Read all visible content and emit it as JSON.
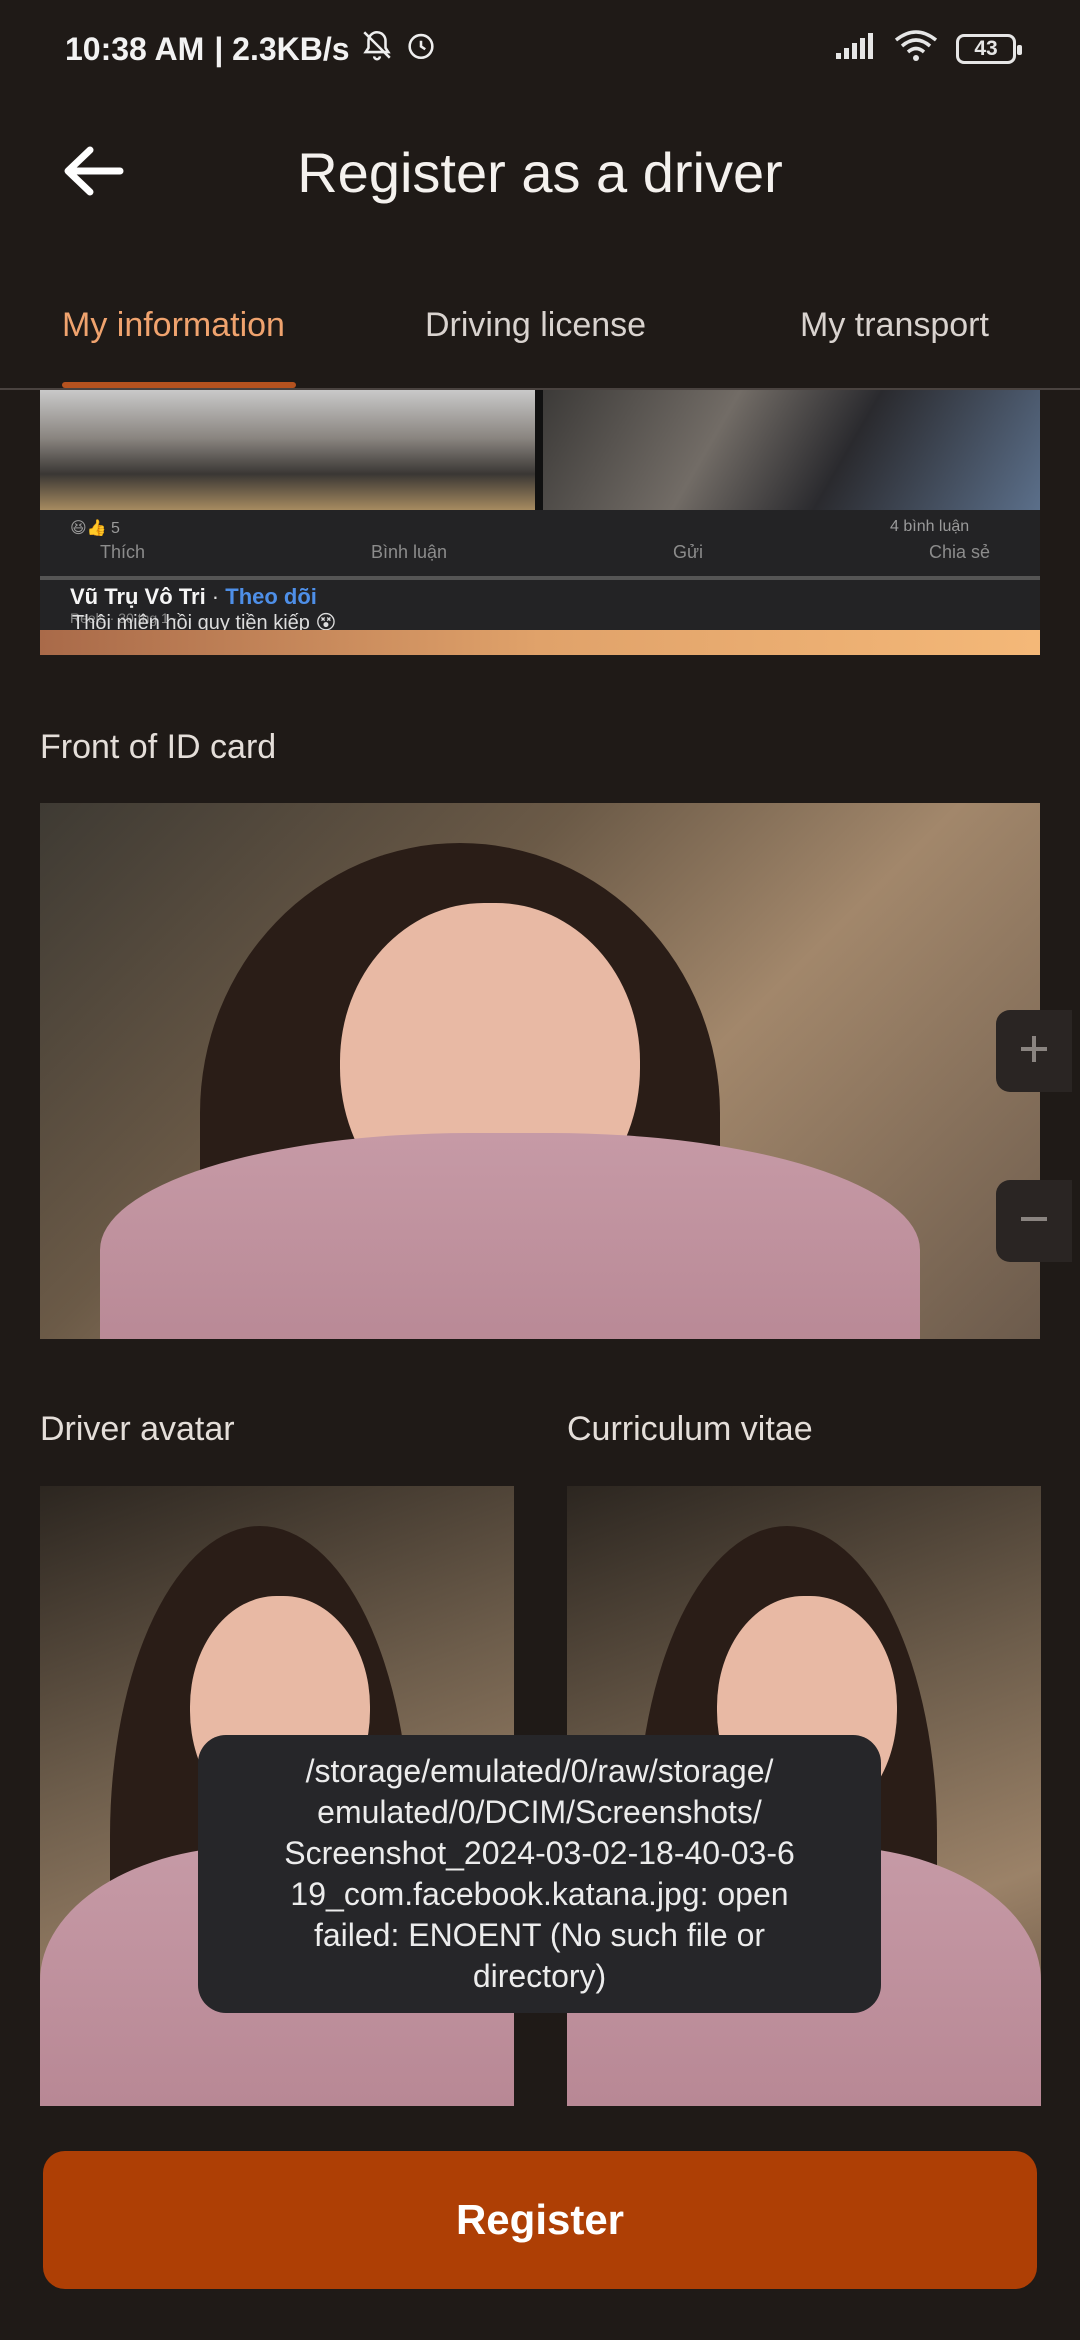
{
  "status_bar": {
    "time": "10:38 AM",
    "speed": "| 2.3KB/s",
    "battery": "43",
    "icons": [
      "bell-muted-icon",
      "alarm-icon",
      "signal-icon",
      "wifi-icon",
      "battery-icon"
    ]
  },
  "app_bar": {
    "title": "Register as a driver",
    "back_icon": "arrow-left-icon"
  },
  "tabs": [
    {
      "label": "My information",
      "active": true
    },
    {
      "label": "Driving license",
      "active": false
    },
    {
      "label": "My transport",
      "active": false
    }
  ],
  "top_thumbnail": {
    "reactions_count": "5",
    "comments": "4 bình luận",
    "actions": [
      "Thích",
      "Bình luận",
      "Gửi",
      "Chia sẻ"
    ],
    "author": "Vũ Trụ Vô Tri",
    "follow": "Theo dõi",
    "meta": "Reels · 30 thg 1 ·",
    "caption": "Thôi miên hồi quy tiền kiếp 😵"
  },
  "sections": {
    "front_id_label": "Front of ID card",
    "driver_avatar_label": "Driver avatar",
    "cv_label": "Curriculum vitae"
  },
  "zoom": {
    "plus_icon": "plus-icon",
    "minus_icon": "minus-icon"
  },
  "toast": {
    "message": "/storage/emulated/0/raw/storage/\nemulated/0/DCIM/Screenshots/\nScreenshot_2024-03-02-18-40-03-6\n19_com.facebook.katana.jpg: open\nfailed: ENOENT (No such file or\ndirectory)"
  },
  "register_button": {
    "label": "Register"
  },
  "colors": {
    "background": "#1f1a17",
    "accent": "#ae3f05",
    "active_tab": "#f0a36e"
  }
}
